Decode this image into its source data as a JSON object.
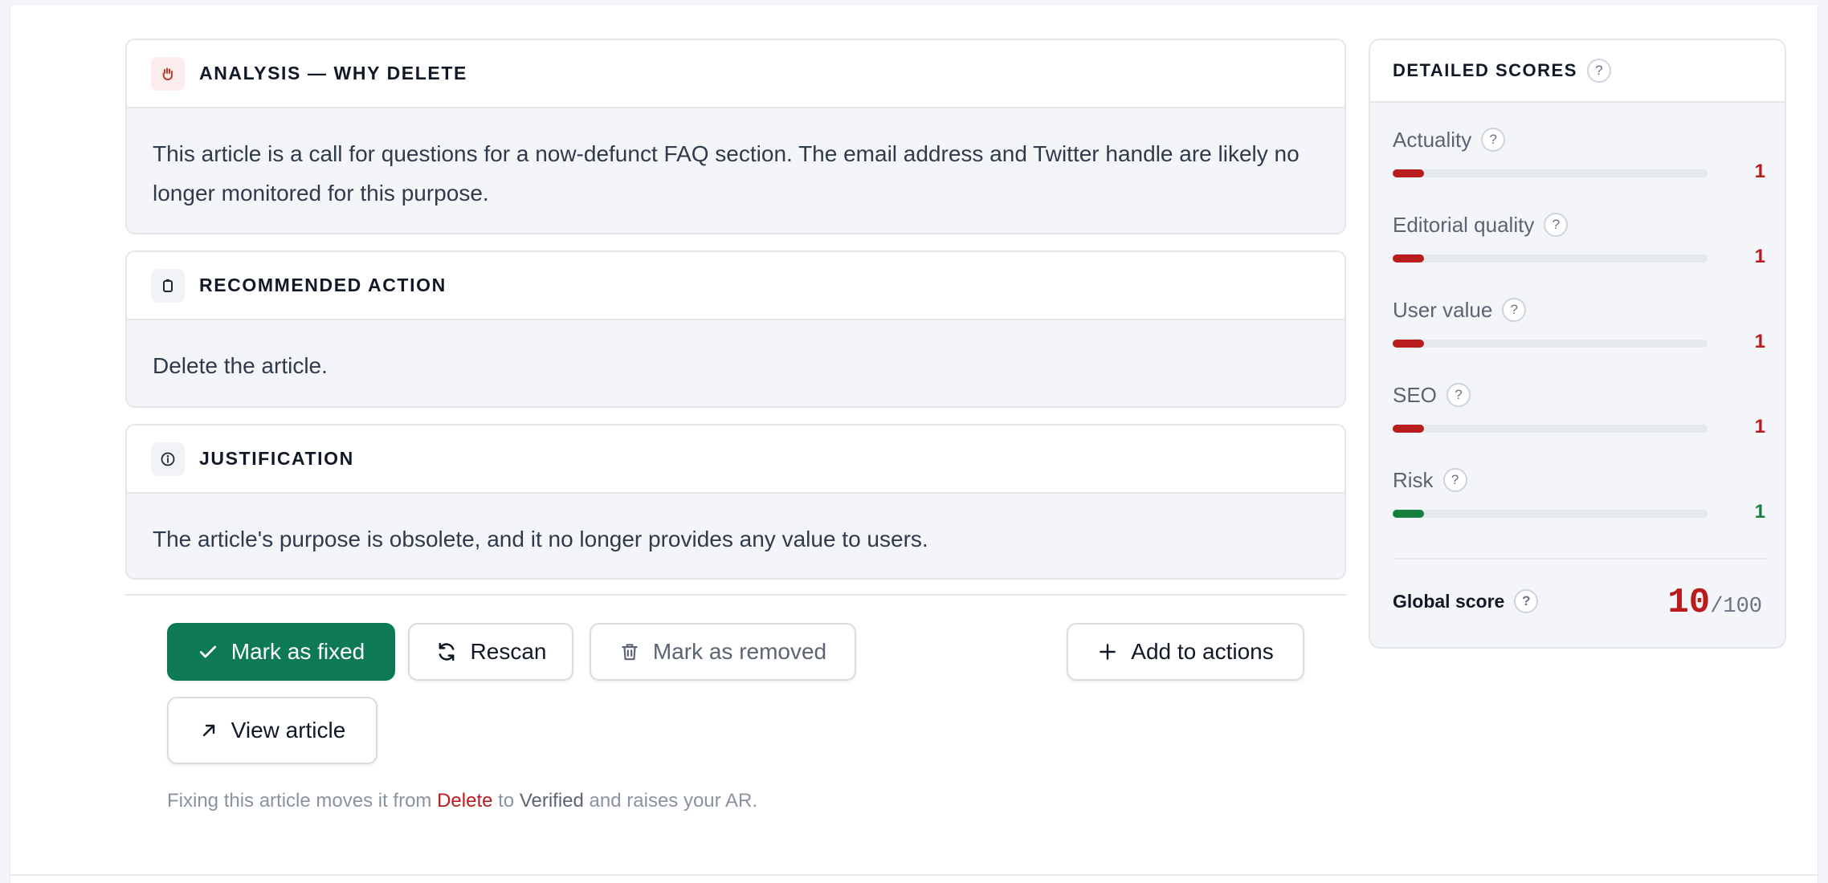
{
  "analysis": {
    "title": "ANALYSIS — WHY DELETE",
    "icon": "hand-icon",
    "text": "This article is a call for questions for a now-defunct FAQ section. The email address and Twitter handle are likely no longer monitored for this purpose."
  },
  "recommended": {
    "title": "RECOMMENDED ACTION",
    "icon": "clipboard-icon",
    "text": "Delete the article."
  },
  "justification": {
    "title": "JUSTIFICATION",
    "icon": "info-icon",
    "text": "The article's purpose is obsolete, and it no longer provides any value to users."
  },
  "actions": {
    "mark_fixed": "Mark as fixed",
    "rescan": "Rescan",
    "mark_removed": "Mark as removed",
    "add_to_actions": "Add to actions",
    "view_article": "View article"
  },
  "note": {
    "prefix": "Fixing this article moves it from ",
    "from": "Delete",
    "middle": " to ",
    "to": "Verified",
    "suffix": " and raises your AR."
  },
  "scores": {
    "title": "DETAILED SCORES",
    "help": "?",
    "items": [
      {
        "label": "Actuality",
        "value": "1",
        "fraction": 0.1,
        "status": "bad"
      },
      {
        "label": "Editorial quality",
        "value": "1",
        "fraction": 0.1,
        "status": "bad"
      },
      {
        "label": "User value",
        "value": "1",
        "fraction": 0.1,
        "status": "bad"
      },
      {
        "label": "SEO",
        "value": "1",
        "fraction": 0.1,
        "status": "bad"
      },
      {
        "label": "Risk",
        "value": "1",
        "fraction": 0.1,
        "status": "good"
      }
    ],
    "global_label": "Global score",
    "global_value": "10",
    "global_max": "/100"
  },
  "colors": {
    "primary": "#0d7a55",
    "danger": "#b91c1c",
    "success": "#15803d"
  }
}
